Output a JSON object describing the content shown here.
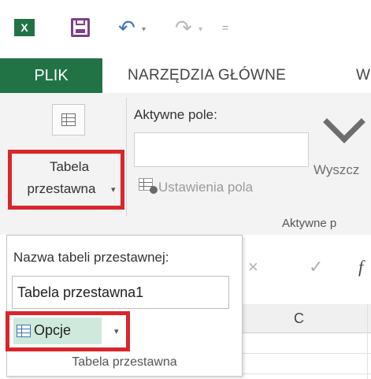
{
  "qat": {
    "excel_logo": "X",
    "undo_glyph": "↶",
    "redo_glyph": "↷",
    "caret_glyph": "▾",
    "customize_glyph": "="
  },
  "tabs": {
    "file": "PLIK",
    "home": "NARZĘDZIA GŁÓWNE",
    "next_partial": "W"
  },
  "ribbon": {
    "pivot_table_button": {
      "line1": "Tabela",
      "line2": "przestawna",
      "caret": "▾"
    },
    "active_field_label": "Aktywne pole:",
    "active_field_value": "",
    "field_settings_label": "Ustawienia pola",
    "drill_label_partial": "Wyszcz",
    "active_group_label_partial": "Aktywne p"
  },
  "dropdown": {
    "name_label": "Nazwa tabeli przestawnej:",
    "name_value": "Tabela przestawna1",
    "options_label": "Opcje",
    "options_caret": "▾",
    "group_label": "Tabela przestawna"
  },
  "formula_bar": {
    "cancel_glyph": "×",
    "enter_glyph": "✓",
    "fx_partial": "f"
  },
  "grid": {
    "column_c": "C"
  },
  "colors": {
    "excel_green": "#217346",
    "highlight_red": "#d9262c",
    "opcje_bg": "#cfe9dc",
    "save_purple": "#7a3f8e",
    "undo_blue": "#3e73b8"
  }
}
